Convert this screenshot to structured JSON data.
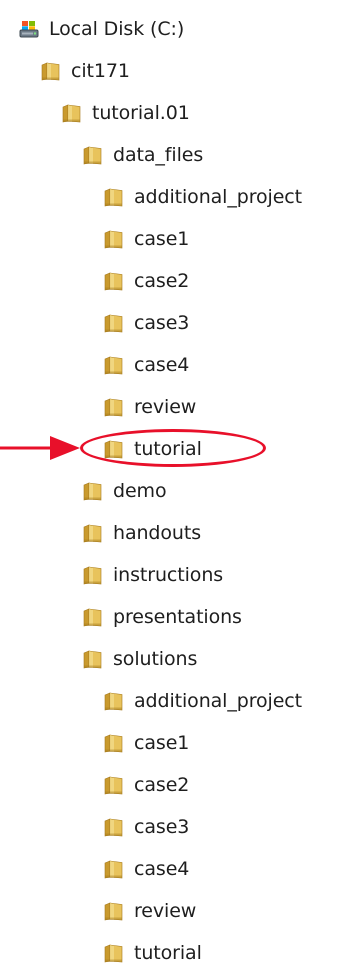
{
  "colors": {
    "folder_front": "#e8c35c",
    "folder_back": "#c99a2e",
    "folder_edge": "#a5791b",
    "highlight": "#e8102a",
    "text": "#1e1e1e"
  },
  "tree": {
    "drive": {
      "label": "Local Disk (C:)",
      "icon": "hard-drive-icon"
    },
    "items": [
      {
        "label": "cit171",
        "icon": "folder-icon",
        "depth": 1
      },
      {
        "label": "tutorial.01",
        "icon": "folder-icon",
        "depth": 2
      },
      {
        "label": "data_files",
        "icon": "folder-icon",
        "depth": 3
      },
      {
        "label": "additional_project",
        "icon": "folder-icon",
        "depth": 4
      },
      {
        "label": "case1",
        "icon": "folder-icon",
        "depth": 4
      },
      {
        "label": "case2",
        "icon": "folder-icon",
        "depth": 4
      },
      {
        "label": "case3",
        "icon": "folder-icon",
        "depth": 4
      },
      {
        "label": "case4",
        "icon": "folder-icon",
        "depth": 4
      },
      {
        "label": "review",
        "icon": "folder-icon",
        "depth": 4
      },
      {
        "label": "tutorial",
        "icon": "folder-icon",
        "depth": 4,
        "highlighted": true
      },
      {
        "label": "demo",
        "icon": "folder-icon",
        "depth": 3
      },
      {
        "label": "handouts",
        "icon": "folder-icon",
        "depth": 3
      },
      {
        "label": "instructions",
        "icon": "folder-icon",
        "depth": 3
      },
      {
        "label": "presentations",
        "icon": "folder-icon",
        "depth": 3
      },
      {
        "label": "solutions",
        "icon": "folder-icon",
        "depth": 3
      },
      {
        "label": "additional_project",
        "icon": "folder-icon",
        "depth": 4
      },
      {
        "label": "case1",
        "icon": "folder-icon",
        "depth": 4
      },
      {
        "label": "case2",
        "icon": "folder-icon",
        "depth": 4
      },
      {
        "label": "case3",
        "icon": "folder-icon",
        "depth": 4
      },
      {
        "label": "case4",
        "icon": "folder-icon",
        "depth": 4
      },
      {
        "label": "review",
        "icon": "folder-icon",
        "depth": 4
      },
      {
        "label": "tutorial",
        "icon": "folder-icon",
        "depth": 4
      }
    ]
  },
  "annotation": {
    "arrow_icon": "arrow-right-icon",
    "highlight_shape": "ellipse"
  }
}
